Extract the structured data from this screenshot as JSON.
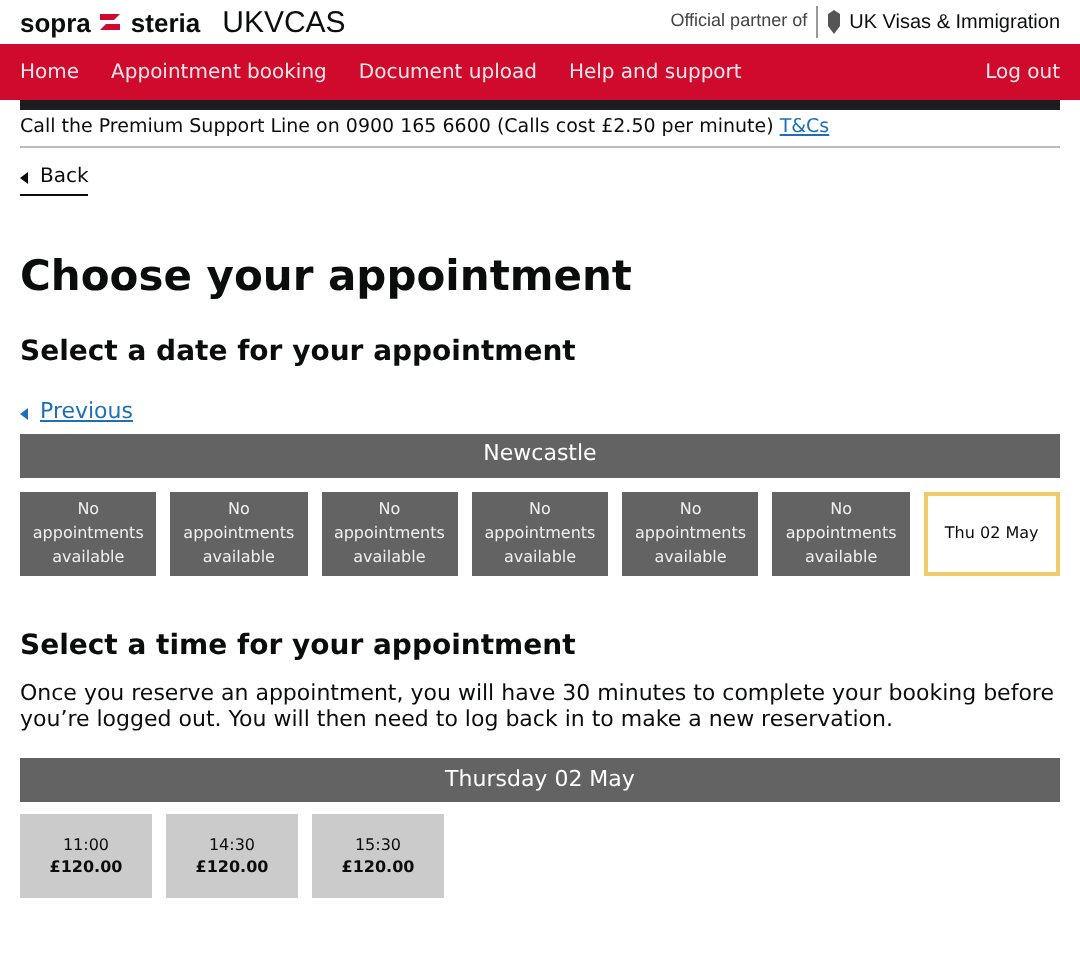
{
  "header": {
    "brand": "sopra",
    "brand_2": "steria",
    "product": "UKVCAS",
    "partner_label": "Official partner of",
    "partner": "UK Visas & Immigration"
  },
  "nav": {
    "items": [
      "Home",
      "Appointment booking",
      "Document upload",
      "Help and support"
    ],
    "logout": "Log out"
  },
  "support": {
    "text": "Call the Premium Support Line on 0900 165 6600 (Calls cost £2.50 per minute)",
    "link": "T&Cs"
  },
  "back": "Back",
  "title": "Choose your appointment",
  "date_section": {
    "heading": "Select a date for your appointment",
    "previous": "Previous",
    "location": "Newcastle",
    "dates": [
      {
        "label": "No appointments available",
        "available": false,
        "selected": false
      },
      {
        "label": "No appointments available",
        "available": false,
        "selected": false
      },
      {
        "label": "No appointments available",
        "available": false,
        "selected": false
      },
      {
        "label": "No appointments available",
        "available": false,
        "selected": false
      },
      {
        "label": "No appointments available",
        "available": false,
        "selected": false
      },
      {
        "label": "No appointments available",
        "available": false,
        "selected": false
      },
      {
        "label": "Thu 02 May",
        "available": true,
        "selected": true
      }
    ]
  },
  "time_section": {
    "heading": "Select a time for your appointment",
    "note": "Once you reserve an appointment, you will have 30 minutes to complete your booking before you’re logged out. You will then need to log back in to make a new reservation.",
    "day": "Thursday 02 May",
    "slots": [
      {
        "time": "11:00",
        "price": "£120.00"
      },
      {
        "time": "14:30",
        "price": "£120.00"
      },
      {
        "time": "15:30",
        "price": "£120.00"
      }
    ]
  }
}
